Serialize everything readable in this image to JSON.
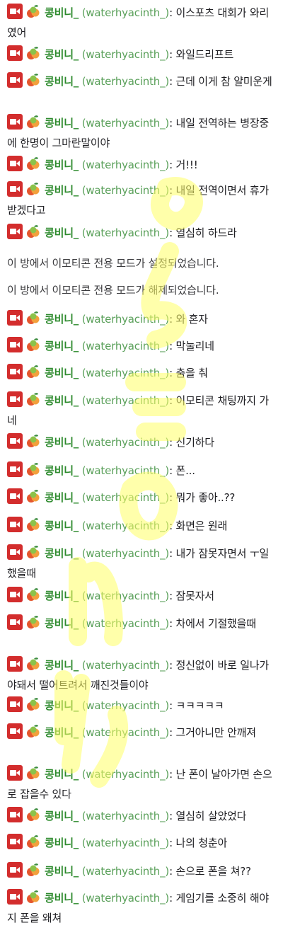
{
  "user": {
    "nickname": "콩비니_",
    "login": "(waterhyacinth_)",
    "separator": ":"
  },
  "colors": {
    "nickname": "#2e8b2e",
    "login": "#5aa05a",
    "watermark": "#ffff66",
    "camera_badge": "#d32d2d"
  },
  "icons": {
    "badge1": "camera-icon",
    "badge2": "fruit-icon"
  },
  "watermark_text": "Jamong",
  "messages": [
    {
      "type": "chat",
      "text": "이스포츠 대회가 와리 였어"
    },
    {
      "type": "chat",
      "text": "와일드리프트"
    },
    {
      "type": "chat",
      "text": "근데 이게 참 얄미운게"
    },
    {
      "type": "chat",
      "text": "내일 전역하는 병장중에 한명이 그마란말이야"
    },
    {
      "type": "chat",
      "text": "거!!!"
    },
    {
      "type": "chat",
      "text": "내일 전역이면서 휴가 받겠다고"
    },
    {
      "type": "chat",
      "text": "열심히 하드라"
    },
    {
      "type": "notice",
      "text": "이 방에서 이모티콘 전용 모드가 설정되었습니다."
    },
    {
      "type": "notice",
      "text": "이 방에서 이모티콘 전용 모드가 해제되었습니다."
    },
    {
      "type": "chat",
      "text": "와 혼자"
    },
    {
      "type": "chat",
      "text": "막눌리네"
    },
    {
      "type": "chat",
      "text": "춤을 춰"
    },
    {
      "type": "chat",
      "text": "이모티콘 채팅까지 가네"
    },
    {
      "type": "chat",
      "text": "신기하다"
    },
    {
      "type": "chat",
      "text": "폰..."
    },
    {
      "type": "chat",
      "text": "뭐가 좋아..??"
    },
    {
      "type": "chat",
      "text": "화면은 원래"
    },
    {
      "type": "chat",
      "text": "내가 잠못자면서 ㅜ일했을때"
    },
    {
      "type": "chat",
      "text": "잠못자서"
    },
    {
      "type": "chat",
      "text": "차에서 기절했을때"
    },
    {
      "type": "chat",
      "text": "정신없이 바로 일나가야돼서 떨어트려서 깨진것들이야"
    },
    {
      "type": "chat",
      "text": "ㅋㅋㅋㅋㅋ"
    },
    {
      "type": "chat",
      "text": "그거아니만 안깨져"
    },
    {
      "type": "chat",
      "text": "난 폰이 날아가면 손으로 잡을수 있다"
    },
    {
      "type": "chat",
      "text": "열심히 살았었다"
    },
    {
      "type": "chat",
      "text": "나의 청춘아"
    },
    {
      "type": "chat",
      "text": "손으로 폰을 쳐??"
    },
    {
      "type": "chat",
      "text": "게임기를 소중히 해야지 폰을 왜쳐"
    }
  ]
}
